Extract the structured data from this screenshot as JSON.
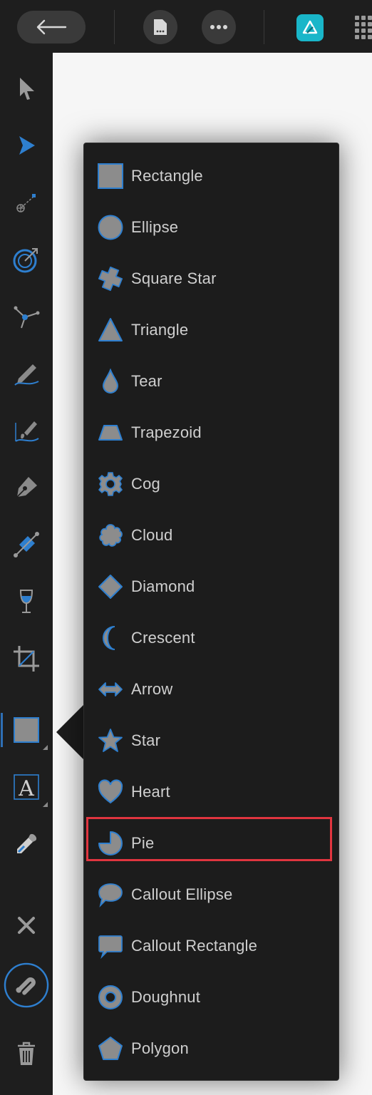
{
  "topbar": {
    "back_icon": "arrow-left-icon",
    "document_icon": "document-menu-icon",
    "more_icon": "ellipsis-icon",
    "app_icon": "affinity-designer-logo",
    "grid_icon": "grid-menu-icon"
  },
  "toolbar": {
    "tools": [
      "move-tool",
      "node-tool",
      "point-transform-tool",
      "corner-tool",
      "vector-crop-node-tool",
      "pencil-tool",
      "vector-brush-tool",
      "pen-tool",
      "fill-tool",
      "transparency-tool",
      "vector-crop-tool",
      "shape-tool",
      "artistic-text-tool",
      "color-picker-tool",
      "close-tool",
      "help-tool",
      "delete-tool"
    ]
  },
  "shapes_menu": {
    "items": [
      {
        "label": "Rectangle",
        "icon": "rectangle-icon"
      },
      {
        "label": "Ellipse",
        "icon": "ellipse-icon"
      },
      {
        "label": "Square Star",
        "icon": "square-star-icon"
      },
      {
        "label": "Triangle",
        "icon": "triangle-icon"
      },
      {
        "label": "Tear",
        "icon": "tear-icon"
      },
      {
        "label": "Trapezoid",
        "icon": "trapezoid-icon"
      },
      {
        "label": "Cog",
        "icon": "cog-icon"
      },
      {
        "label": "Cloud",
        "icon": "cloud-icon"
      },
      {
        "label": "Diamond",
        "icon": "diamond-icon"
      },
      {
        "label": "Crescent",
        "icon": "crescent-icon"
      },
      {
        "label": "Arrow",
        "icon": "double-arrow-icon"
      },
      {
        "label": "Star",
        "icon": "star-icon"
      },
      {
        "label": "Heart",
        "icon": "heart-icon"
      },
      {
        "label": "Pie",
        "icon": "pie-icon"
      },
      {
        "label": "Callout Ellipse",
        "icon": "callout-ellipse-icon"
      },
      {
        "label": "Callout Rectangle",
        "icon": "callout-rectangle-icon"
      },
      {
        "label": "Doughnut",
        "icon": "doughnut-icon"
      },
      {
        "label": "Polygon",
        "icon": "polygon-icon"
      }
    ],
    "highlighted": "Pie"
  },
  "colors": {
    "accent": "#2e6fb5",
    "shape_fill": "#8c8c8c",
    "highlight": "#e0353f",
    "app_logo": "#19b6c9"
  }
}
